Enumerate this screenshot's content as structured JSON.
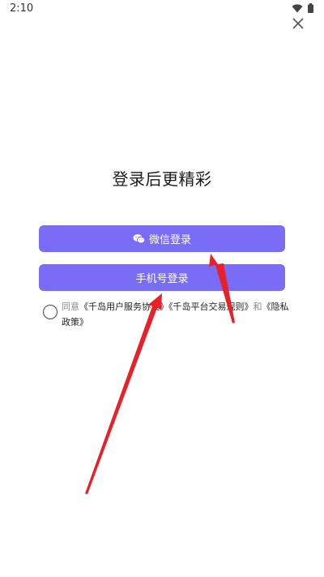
{
  "status_bar": {
    "time": "2:10",
    "wifi_icon": "wifi-icon",
    "battery_icon": "battery-icon"
  },
  "close_icon": "close-icon",
  "title": "登录后更精彩",
  "buttons": {
    "wechat": {
      "label": "微信登录",
      "icon": "wechat-icon"
    },
    "phone": {
      "label": "手机号登录"
    }
  },
  "agreement": {
    "prefix": "同意",
    "user_agreement": "《千岛用户服务协议》",
    "trade_rules": "《千岛平台交易规则》",
    "and": "和",
    "privacy_policy": "《隐私政策》"
  },
  "colors": {
    "accent": "#7a6df5",
    "annotation_arrow": "#e8202a"
  }
}
